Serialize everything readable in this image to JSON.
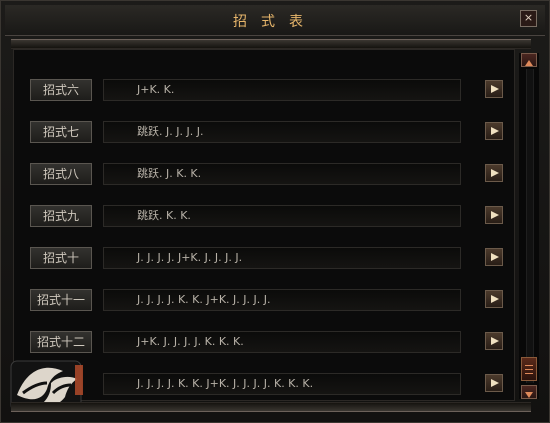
{
  "window": {
    "title": "招式表",
    "close_label": "×"
  },
  "rows": [
    {
      "name": "招式六",
      "sequence": "J+K. K."
    },
    {
      "name": "招式七",
      "sequence": "跳跃. J. J. J. J."
    },
    {
      "name": "招式八",
      "sequence": "跳跃. J. K. K."
    },
    {
      "name": "招式九",
      "sequence": "跳跃. K. K."
    },
    {
      "name": "招式十",
      "sequence": "J. J. J. J. J+K. J. J. J. J."
    },
    {
      "name": "招式十一",
      "sequence": "J. J. J. J. K. K. J+K. J. J. J. J."
    },
    {
      "name": "招式十二",
      "sequence": "J+K. J. J. J. J. K. K. K."
    },
    {
      "name": "",
      "sequence": "J. J. J. J. K. K. J+K. J. J. J. J. K. K. K."
    }
  ],
  "icons": {
    "play": "play-icon",
    "scroll_up": "arrow-up-icon",
    "scroll_down": "arrow-down-icon",
    "close": "close-icon"
  },
  "colors": {
    "title": "#e7b66b",
    "accent": "#b04a2a"
  }
}
